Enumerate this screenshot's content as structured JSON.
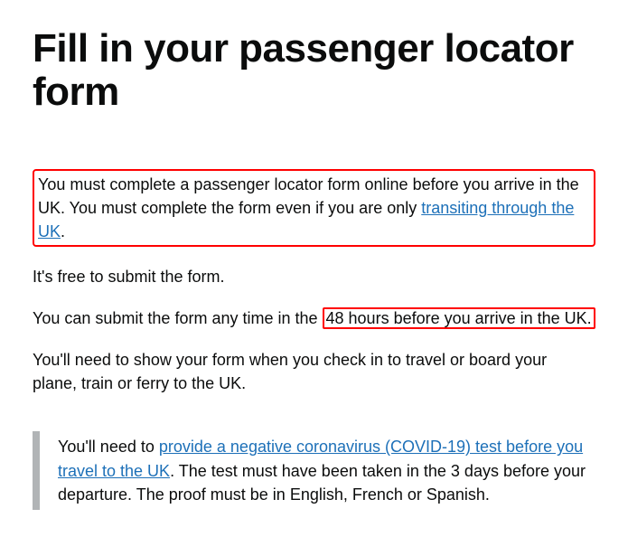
{
  "heading": "Fill in your passenger locator form",
  "para1_part1": "You must complete a passenger locator form online before you arrive in the UK. You must complete the form even if you are only ",
  "para1_link": "transiting through the UK",
  "para1_part2": ".",
  "para2": "It's free to submit the form.",
  "para3_part1": "You can submit the form any time in the ",
  "para3_highlight": "48 hours before you arrive in the UK.",
  "para4": "You'll need to show your form when you check in to travel or board your plane, train or ferry to the UK.",
  "inset_part1": "You'll need to ",
  "inset_link": "provide a negative coronavirus (COVID-19) test before you travel to the UK",
  "inset_part2": ". The test must have been taken in the 3 days before your departure. The proof must be in English, French or Spanish."
}
